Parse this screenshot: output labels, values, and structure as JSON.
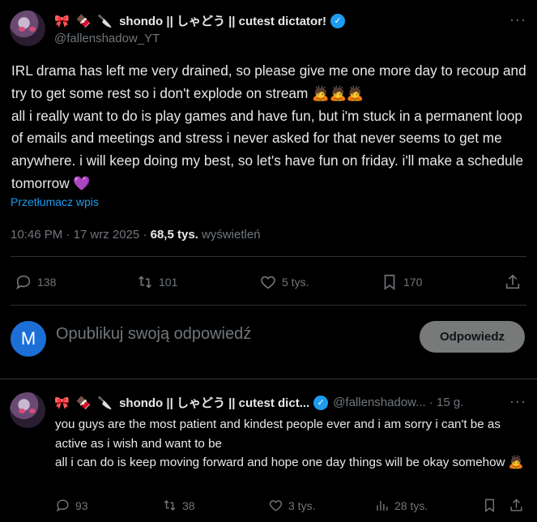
{
  "main_tweet": {
    "emojis": [
      "🎀",
      "🍫",
      "🔪"
    ],
    "display_name": "shondo || しゃどう || cutest dictator!",
    "handle": "@fallenshadow_YT",
    "more_icon": "ellipsis-icon",
    "text": "IRL drama has left me very drained, so please give me one more day to recoup and try to get some rest so i don't explode on stream 🙇🙇🙇\nall i really want to do is play games and have fun, but i'm stuck in a permanent loop of emails and meetings and stress i never asked for that never seems to get me anywhere. i will keep doing my best, so let's have fun on friday. i'll make a schedule tomorrow 💜",
    "translate_label": "Przetłumacz wpis",
    "time": "10:46 PM",
    "date": "17 wrz 2025",
    "views_count": "68,5 tys.",
    "views_label": "wyświetleń",
    "actions": {
      "replies": "138",
      "reposts": "101",
      "likes": "5 tys.",
      "bookmarks": "170"
    }
  },
  "reply_composer": {
    "avatar_letter": "M",
    "placeholder": "Opublikuj swoją odpowiedź",
    "button_label": "Odpowiedz"
  },
  "reply_tweet": {
    "emojis": [
      "🎀",
      "🍫",
      "🔪"
    ],
    "display_name": "shondo || しゃどう || cutest dict...",
    "handle": "@fallenshadow...",
    "age": "15 g.",
    "text": "you guys are the most patient and kindest people ever and i am sorry i can't be as active as i wish and want to be\nall i can do is keep moving forward and hope one day things will be okay somehow 🙇",
    "actions": {
      "replies": "93",
      "reposts": "38",
      "likes": "3 tys.",
      "views": "28 tys."
    }
  },
  "colors": {
    "background": "#000000",
    "text": "#e7e9ea",
    "muted": "#71767b",
    "accent": "#1d9bf0",
    "divider": "#2f3336"
  }
}
